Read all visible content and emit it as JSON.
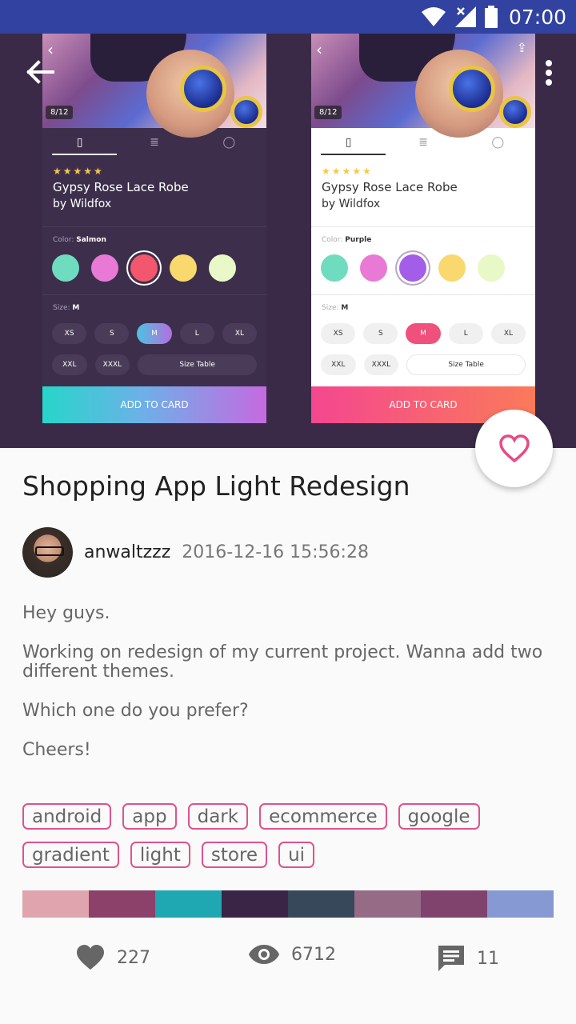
{
  "status_bar": {
    "time": "07:00"
  },
  "mockups": {
    "page_counter": "8/12",
    "rating": "★★★★★",
    "product_title": "Gypsy Rose Lace Robe",
    "product_brand": "by Wildfox",
    "color_label": "Color:",
    "size_label": "Size:",
    "size_value": "M",
    "add_button": "ADD TO CARD",
    "dark": {
      "color_value": "Salmon",
      "swatches": [
        "#6fdcc0",
        "#e87ad6",
        "#f2576d",
        "#f9d86e",
        "#e8f8c7"
      ],
      "selected_index": 2
    },
    "light": {
      "color_value": "Purple",
      "swatches": [
        "#6fdcc0",
        "#e87ad6",
        "#a25ee8",
        "#f9d86e",
        "#e8f8c7"
      ],
      "selected_index": 2
    },
    "sizes_row1": [
      "XS",
      "S",
      "M",
      "L",
      "XL"
    ],
    "sizes_row2": [
      "XXL",
      "XXXL",
      "Size Table"
    ]
  },
  "shot": {
    "title": "Shopping App Light Redesign",
    "author": "anwaltzzz",
    "timestamp": "2016-12-16 15:56:28",
    "description": [
      "Hey guys.",
      "Working on redesign of my current project. Wanna add two different themes.",
      "Which one do you prefer?",
      "Cheers!"
    ],
    "tags": [
      "android",
      "app",
      "dark",
      "ecommerce",
      "google",
      "gradient",
      "light",
      "store",
      "ui"
    ],
    "palette": [
      "#dfa4ad",
      "#8b4169",
      "#1fa8b1",
      "#3a2546",
      "#36485a",
      "#966b86",
      "#7f436d",
      "#8699d2"
    ]
  },
  "stats": {
    "likes": "227",
    "views": "6712",
    "comments": "11"
  },
  "colors": {
    "status_bar": "#3142a0",
    "hero_bg": "#3a2a48",
    "accent": "#e0528a",
    "heart": "#e84a86"
  }
}
